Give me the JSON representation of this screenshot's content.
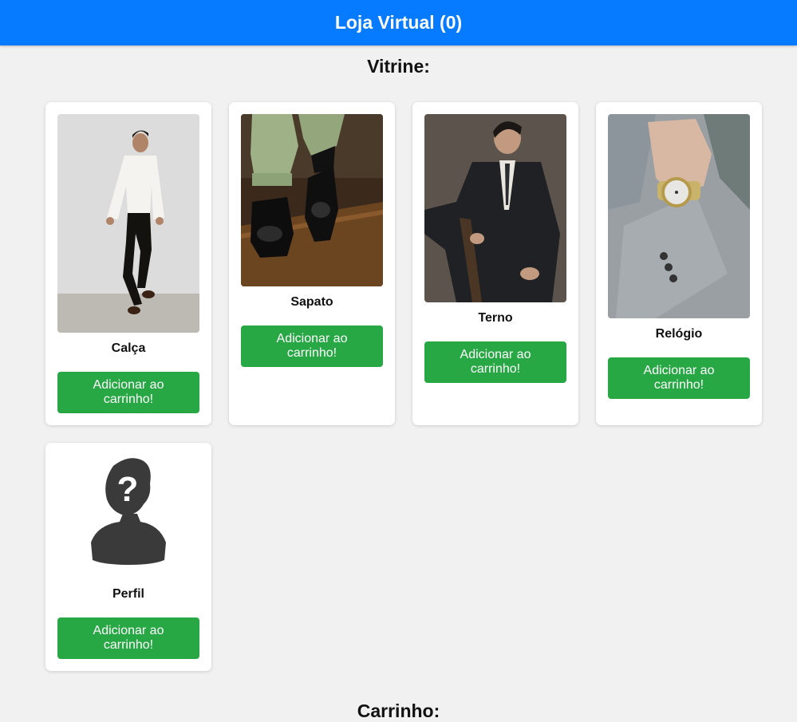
{
  "header": {
    "title": "Loja Virtual (0)"
  },
  "showcase": {
    "title": "Vitrine:"
  },
  "products": [
    {
      "name": "Calça",
      "button": "Adicionar ao carrinho!",
      "image": "man-in-white-shirt-and-black-pants"
    },
    {
      "name": "Sapato",
      "button": "Adicionar ao carrinho!",
      "image": "black-loafer-shoes"
    },
    {
      "name": "Terno",
      "button": "Adicionar ao carrinho!",
      "image": "man-in-dark-suit"
    },
    {
      "name": "Relógio",
      "button": "Adicionar ao carrinho!",
      "image": "wristwatch-on-grey-suit-sleeve"
    },
    {
      "name": "Perfil",
      "button": "Adicionar ao carrinho!",
      "image": "unknown-person-silhouette"
    }
  ],
  "cart": {
    "title": "Carrinho:"
  }
}
